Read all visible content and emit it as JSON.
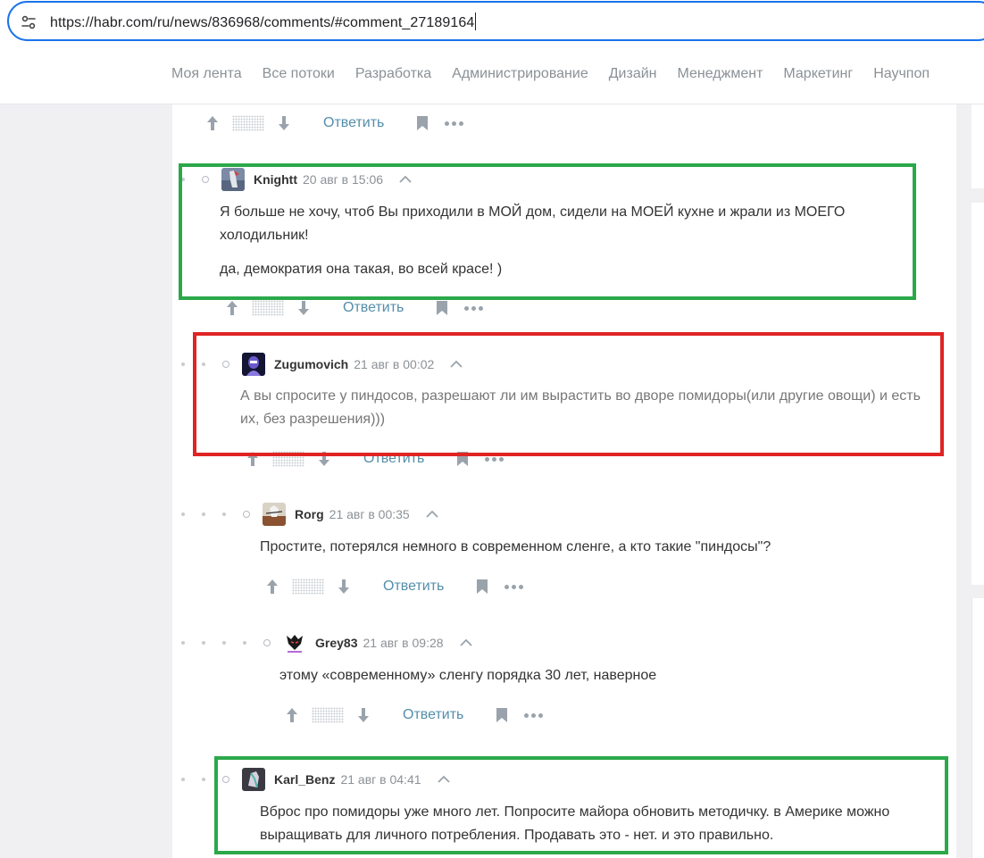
{
  "address_bar": {
    "url": "https://habr.com/ru/news/836968/comments/#comment_27189164"
  },
  "nav": {
    "items": [
      "Моя лента",
      "Все потоки",
      "Разработка",
      "Администрирование",
      "Дизайн",
      "Менеджмент",
      "Маркетинг",
      "Научпоп"
    ]
  },
  "actions": {
    "reply_label": "Ответить"
  },
  "comments": [
    {
      "username": "Knightt",
      "time": "20 авг в 15:06",
      "paragraphs": [
        "Я больше не хочу, чтоб Вы приходили в МОЙ дом, сидели на МОЕЙ кухне и жрали из МОЕГО холодильник!",
        "да, демократия она такая, во всей красе! )"
      ],
      "highlight_color": "#2ba84a"
    },
    {
      "username": "Zugumovich",
      "time": "21 авг в 00:02",
      "paragraphs": [
        "А вы спросите у пиндосов, разрешают ли им вырастить во дворе помидоры(или другие овощи) и есть их, без разрешения)))"
      ],
      "highlight_color": "#e02424"
    },
    {
      "username": "Rorg",
      "time": "21 авг в 00:35",
      "paragraphs": [
        "Простите, потерялся немного в современном сленге, а кто такие \"пиндосы\"?"
      ]
    },
    {
      "username": "Grey83",
      "time": "21 авг в 09:28",
      "paragraphs": [
        "этому «современному» сленгу порядка 30 лет, наверное"
      ]
    },
    {
      "username": "Karl_Benz",
      "time": "21 авг в 04:41",
      "paragraphs": [
        "Вброс про помидоры уже много лет. Попросите майора обновить методичку. в Америке можно выращивать для личного потребления. Продавать это - нет. и это правильно."
      ],
      "highlight_color": "#2ba84a"
    }
  ]
}
